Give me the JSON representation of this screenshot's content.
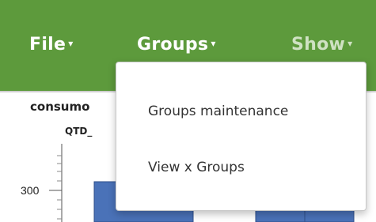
{
  "navbar": {
    "file_label": "File",
    "groups_label": "Groups",
    "show_label": "Show",
    "caret": "▾",
    "bg_color": "#5d9a3c"
  },
  "dropdown": {
    "items": [
      {
        "label": "Groups maintenance"
      },
      {
        "label": "View x Groups"
      }
    ]
  },
  "chart_data": {
    "type": "bar",
    "title": "consumo",
    "subtitle": "QTD_",
    "y_ticks": [
      300
    ],
    "bar_color": "#4a72b8"
  }
}
